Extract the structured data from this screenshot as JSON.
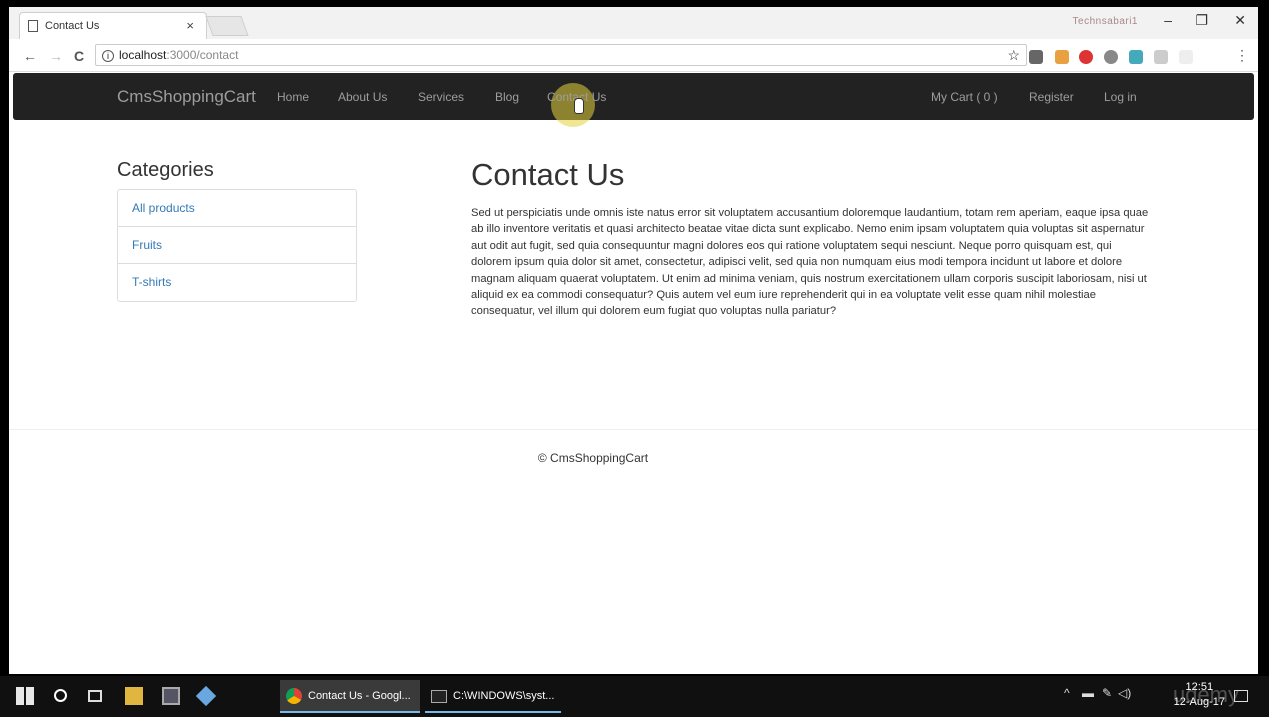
{
  "browser": {
    "tab_title": "Contact Us",
    "tab_close": "×",
    "profile_name": "Technsabari1",
    "minimize": "–",
    "restore": "❐",
    "close": "✕",
    "back": "←",
    "forward": "→",
    "reload": "C",
    "info": "i",
    "url_host": "localhost",
    "url_path": ":3000/contact",
    "star": "☆",
    "menu": "⋮"
  },
  "navbar": {
    "brand": "CmsShoppingCart",
    "links": [
      "Home",
      "About Us",
      "Services",
      "Blog",
      "Contact Us"
    ],
    "cart": "My Cart ( 0 )",
    "register": "Register",
    "login": "Log in"
  },
  "sidebar": {
    "title": "Categories",
    "items": [
      "All products",
      "Fruits",
      "T-shirts"
    ]
  },
  "main": {
    "title": "Contact Us",
    "body": "Sed ut perspiciatis unde omnis iste natus error sit voluptatem accusantium doloremque laudantium, totam rem aperiam, eaque ipsa quae ab illo inventore veritatis et quasi architecto beatae vitae dicta sunt explicabo. Nemo enim ipsam voluptatem quia voluptas sit aspernatur aut odit aut fugit, sed quia consequuntur magni dolores eos qui ratione voluptatem sequi nesciunt. Neque porro quisquam est, qui dolorem ipsum quia dolor sit amet, consectetur, adipisci velit, sed quia non numquam eius modi tempora incidunt ut labore et dolore magnam aliquam quaerat voluptatem. Ut enim ad minima veniam, quis nostrum exercitationem ullam corporis suscipit laboriosam, nisi ut aliquid ex ea commodi consequatur? Quis autem vel eum iure reprehenderit qui in ea voluptate velit esse quam nihil molestiae consequatur, vel illum qui dolorem eum fugiat quo voluptas nulla pariatur?"
  },
  "footer": {
    "text": "© CmsShoppingCart"
  },
  "taskbar": {
    "tasks": [
      "Contact Us - Googl...",
      "C:\\WINDOWS\\syst..."
    ],
    "time": "12:51",
    "date": "12-Aug-17",
    "watermark": "udemy"
  }
}
